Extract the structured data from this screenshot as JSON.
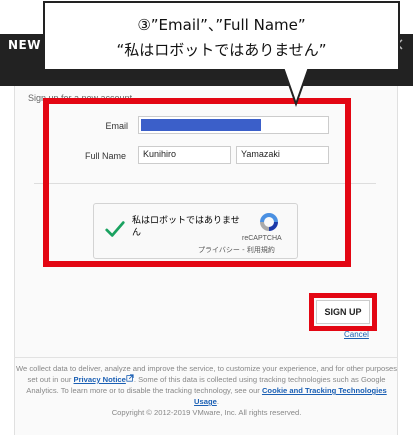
{
  "modal": {
    "title": "NEW",
    "close_glyph": "×",
    "intro": "Sign up for a new account."
  },
  "form": {
    "email_label": "Email",
    "fullname_label": "Full Name",
    "first_name_value": "Kunihiro",
    "last_name_value": "Yamazaki"
  },
  "recaptcha": {
    "checkbox_label": "私はロボットではありません",
    "brand": "reCAPTCHA",
    "privacy": "プライバシー",
    "separator": " - ",
    "terms": "利用規約"
  },
  "actions": {
    "signup_label": "SIGN UP",
    "cancel_label": "Cancel"
  },
  "footer": {
    "part1": "We collect data to deliver, analyze and improve the service, to customize your experience, and for other purposes set out in our ",
    "privacy_link": "Privacy Notice",
    "part2": ". Some of this data is collected using tracking technologies such as Google Analytics. To learn more or to disable the tracking technology, see our ",
    "cookie_link": "Cookie and Tracking Technologies Usage",
    "part3": ".",
    "copyright": "Copyright © 2012-2019 VMware, Inc. All rights reserved."
  },
  "callout": {
    "line1": "③”Email”、”Full Name”",
    "line2": "“私はロボットではありません”"
  },
  "colors": {
    "annotation_red": "#e30613",
    "email_redaction": "#3b5fc9",
    "link_blue": "#1a5fb4",
    "header_dark": "#222222"
  },
  "icons": [
    "close-icon",
    "checkmark-icon",
    "recaptcha-logo-icon",
    "external-link-icon"
  ]
}
